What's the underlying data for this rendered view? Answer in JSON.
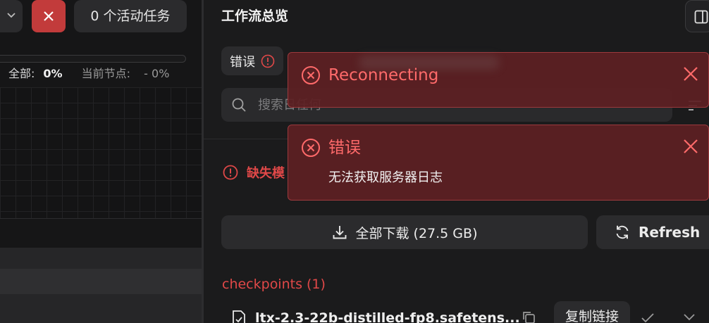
{
  "left": {
    "active_tasks": "0 个活动任务",
    "overall_label": "全部:",
    "overall_value": "0%",
    "node_label": "当前节点:",
    "node_value": "- 0%"
  },
  "right": {
    "title": "工作流总览",
    "filter_chip": "错误",
    "search_placeholder": "搜索日任何",
    "missing_label": "缺失模",
    "download_all": "全部下载 (27.5 GB)",
    "refresh": "Refresh",
    "section_title": "checkpoints (1)",
    "file": {
      "name": "ltx-2.3-22b-distilled-fp8.safetens...",
      "copy_link": "复制链接"
    }
  },
  "toasts": [
    {
      "title": "Reconnecting",
      "message": ""
    },
    {
      "title": "错误",
      "message": "无法获取服务器日志"
    }
  ],
  "colors": {
    "danger": "#e04848",
    "toast_bg": "#5c1f22",
    "surface": "#2b2b2d",
    "background": "#1b1b1c"
  }
}
